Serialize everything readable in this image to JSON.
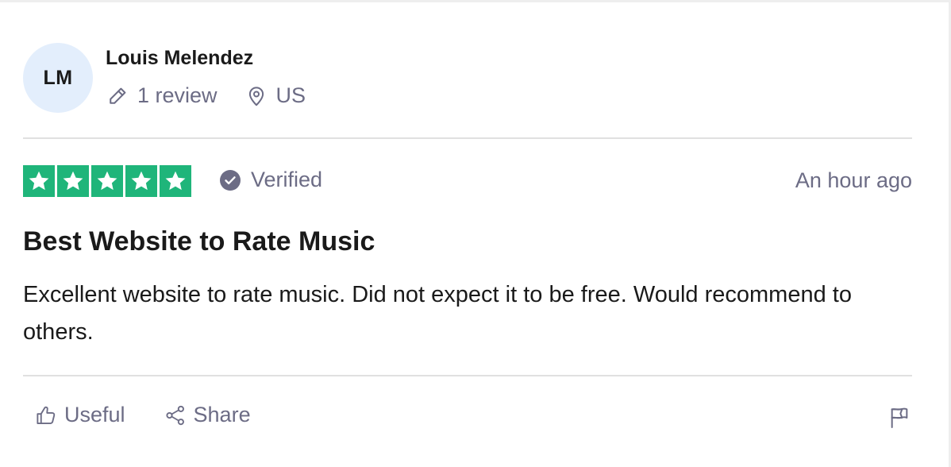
{
  "reviewer": {
    "initials": "LM",
    "name": "Louis Melendez",
    "review_count": "1 review",
    "country": "US",
    "icons": {
      "reviews": "pencil-icon",
      "location": "location-pin-icon"
    }
  },
  "review": {
    "rating": 5,
    "rating_max": 5,
    "verified_label": "Verified",
    "date": "An hour ago",
    "title": "Best Website to Rate Music",
    "body": "Excellent website to rate music. Did not expect it to be free. Would recommend to others."
  },
  "actions": {
    "useful_label": "Useful",
    "share_label": "Share",
    "icons": {
      "useful": "thumbs-up-icon",
      "share": "share-icon",
      "report": "flag-icon"
    }
  },
  "colors": {
    "star_fill": "#1fb57a",
    "avatar_bg": "#e3eefc",
    "muted_text": "#6c6c85",
    "text": "#1a1a1a",
    "divider": "#e0e0e0"
  }
}
